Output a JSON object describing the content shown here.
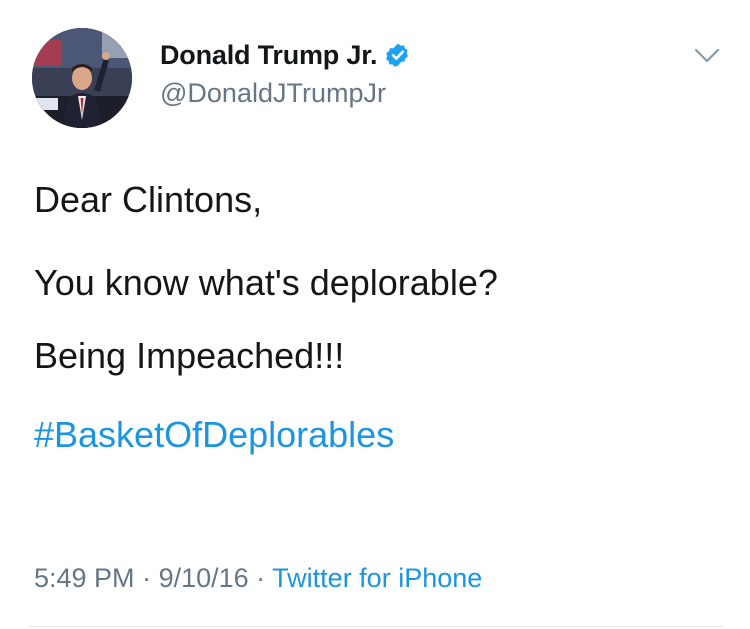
{
  "author": {
    "display_name": "Donald Trump Jr.",
    "handle": "@DonaldJTrumpJr",
    "verified_icon": "verified-badge-icon",
    "avatar_icon": "profile-photo"
  },
  "menu": {
    "icon": "chevron-down-icon"
  },
  "tweet": {
    "line1": "Dear Clintons,",
    "line2": "You know what's deplorable?",
    "line3": "Being Impeached!!!",
    "hashtag": "#BasketOfDeplorables"
  },
  "meta": {
    "time": "5:49 PM",
    "sep1": " · ",
    "date": "9/10/16",
    "sep2": " · ",
    "source": "Twitter for iPhone"
  },
  "colors": {
    "text": "#14171a",
    "secondary": "#657786",
    "link": "#1b95e0",
    "verified": "#1da1f2"
  }
}
